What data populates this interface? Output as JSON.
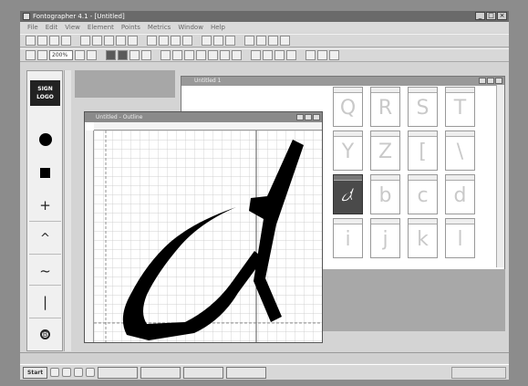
{
  "window": {
    "title": "Fontographer 4.1 - [Untitled]"
  },
  "menu": [
    "File",
    "Edit",
    "View",
    "Element",
    "Points",
    "Metrics",
    "Window",
    "Help"
  ],
  "toolbar": {
    "zoom_value": "200%"
  },
  "palette": {
    "logo_line1": "SIGN",
    "logo_line2": "LOGO",
    "tools": [
      "circle-tool",
      "square-tool",
      "plus-tool",
      "caret-tool",
      "wave-tool",
      "line-tool",
      "corner-tool"
    ]
  },
  "font_window": {
    "title": "Untitled 1",
    "glyphs": [
      "Q",
      "R",
      "S",
      "T",
      "Y",
      "Z",
      "[",
      "\\",
      "",
      "b",
      "c",
      "d",
      "i",
      "j",
      "k",
      "l"
    ],
    "selected_glyph": "a"
  },
  "edit_window": {
    "title": "Untitled - Outline"
  },
  "status": {
    "center": "",
    "right": ""
  },
  "taskbar": {
    "start_label": "Start",
    "items": [
      "",
      "",
      "",
      ""
    ],
    "clock": ""
  },
  "colors": {
    "screen_bg": "#d4d4d4",
    "title_bar": "#6a6a6a",
    "selected_cell": "#4a4a4a"
  }
}
